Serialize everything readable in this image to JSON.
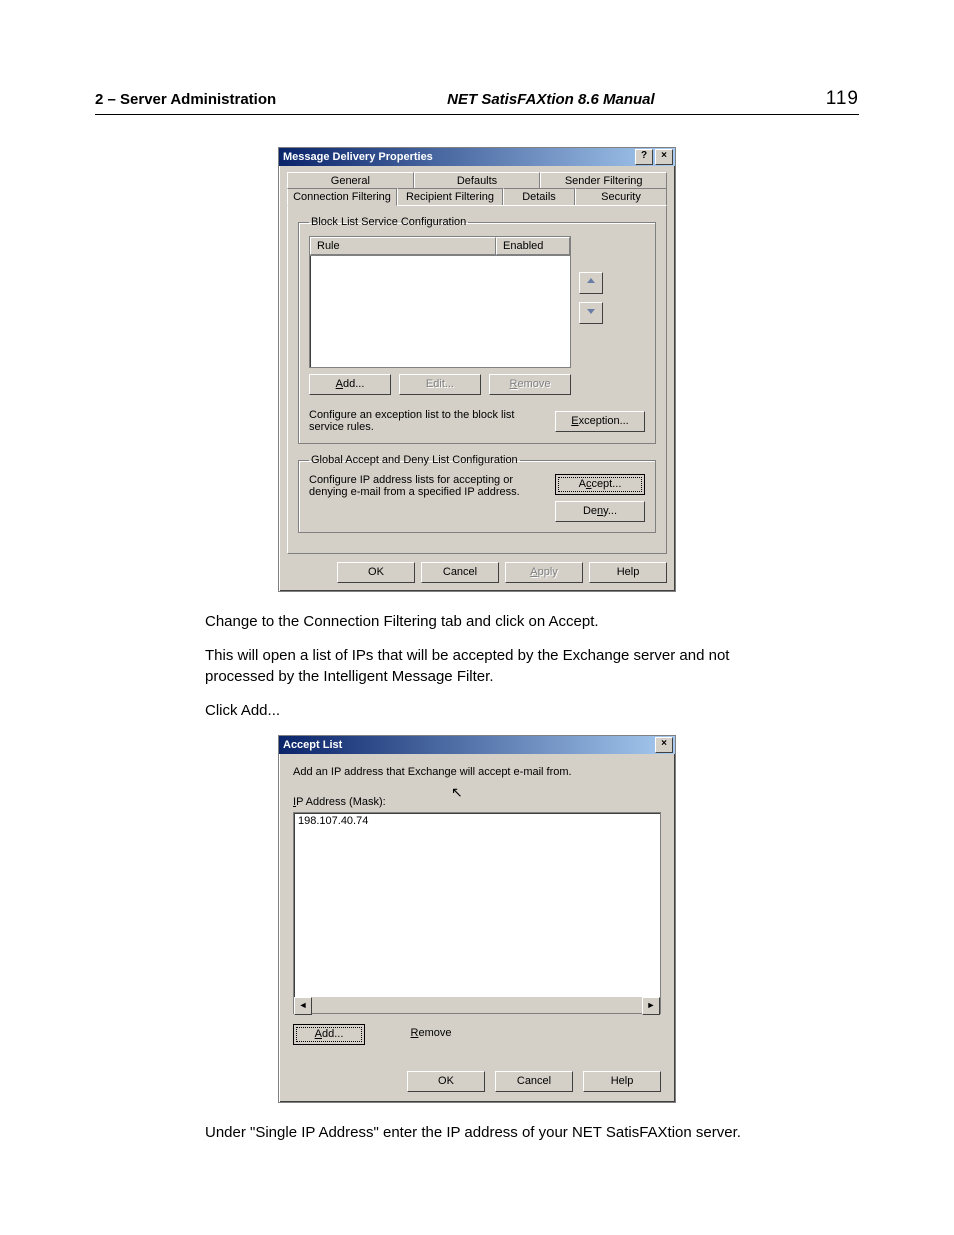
{
  "header": {
    "left": "2  – Server Administration",
    "center": "NET SatisFAXtion 8.6 Manual",
    "page": "119"
  },
  "dialog1": {
    "title": "Message Delivery Properties",
    "tabs_row1": [
      "General",
      "Defaults",
      "Sender Filtering"
    ],
    "tabs_row2": [
      "Connection Filtering",
      "Recipient Filtering",
      "Details",
      "Security"
    ],
    "group1": {
      "legend": "Block List Service Configuration",
      "col_rule": "Rule",
      "col_enabled": "Enabled",
      "add": "Add...",
      "edit": "Edit...",
      "remove": "Remove",
      "exception_text": "Configure an exception list to the block list service rules.",
      "exception_btn": "Exception..."
    },
    "group2": {
      "legend": "Global Accept and Deny List Configuration",
      "text": "Configure IP address lists for accepting or denying e-mail from a specified IP address.",
      "accept": "Accept...",
      "deny": "Deny..."
    },
    "footer": {
      "ok": "OK",
      "cancel": "Cancel",
      "apply": "Apply",
      "help": "Help"
    }
  },
  "para1": "Change to the Connection Filtering tab and click on Accept.",
  "para2": "This will open a list of IPs that will be accepted by the Exchange server and not processed by the Intelligent Message Filter.",
  "para3": "Click Add...",
  "dialog2": {
    "title": "Accept List",
    "instruction": "Add an IP address that Exchange will accept e-mail from.",
    "label": "IP Address (Mask):",
    "item": "198.107.40.74",
    "add": "Add...",
    "remove": "Remove",
    "ok": "OK",
    "cancel": "Cancel",
    "help": "Help"
  },
  "para4": "Under \"Single IP Address\" enter the IP address of your NET SatisFAXtion server."
}
